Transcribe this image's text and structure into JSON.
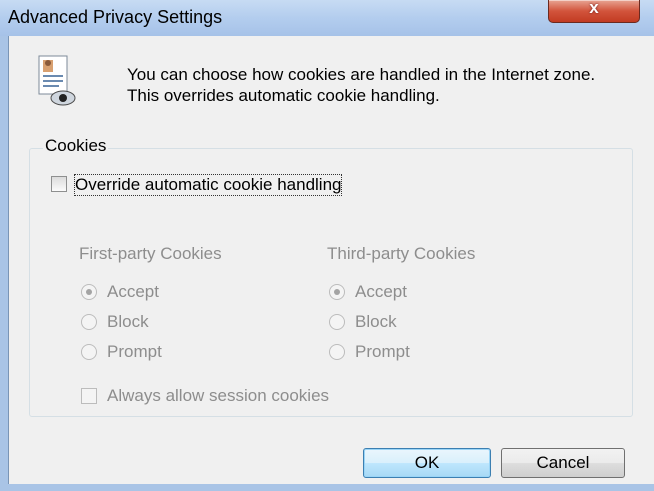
{
  "window": {
    "title": "Advanced Privacy Settings",
    "close_glyph": "x"
  },
  "intro_text": "You can choose how cookies are handled in the Internet zone.  This overrides automatic cookie handling.",
  "group": {
    "legend": "Cookies"
  },
  "override": {
    "label": "Override automatic cookie handling",
    "checked": false
  },
  "first_party": {
    "heading": "First-party Cookies",
    "options": [
      "Accept",
      "Block",
      "Prompt"
    ],
    "selected": "Accept"
  },
  "third_party": {
    "heading": "Third-party Cookies",
    "options": [
      "Accept",
      "Block",
      "Prompt"
    ],
    "selected": "Accept"
  },
  "session": {
    "label": "Always allow session cookies",
    "checked": false
  },
  "buttons": {
    "ok": "OK",
    "cancel": "Cancel"
  },
  "colors": {
    "titlebar": "#b3cdee",
    "close": "#c23b22",
    "dialog_bg": "#f0f0f0",
    "disabled_text": "#8d8d8d"
  }
}
